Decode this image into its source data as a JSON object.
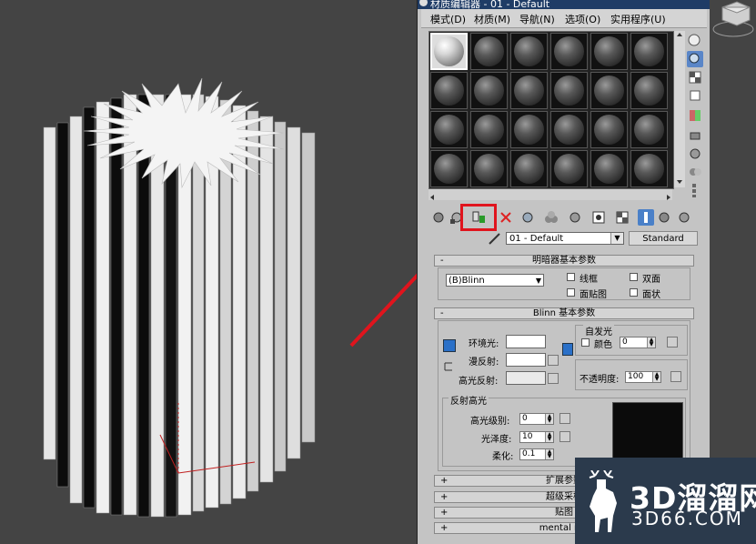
{
  "window_title": "材质编辑器 - 01 - Default",
  "menu": [
    "模式(D)",
    "材质(M)",
    "导航(N)",
    "选项(O)",
    "实用程序(U)"
  ],
  "material_name": "01 - Default",
  "material_type": "Standard",
  "shader_params": {
    "title": "明暗器基本参数",
    "shader": "(B)Blinn",
    "wire": "线框",
    "two_sided": "双面",
    "face_map": "面贴图",
    "faceted": "面状"
  },
  "blinn_params": {
    "title": "Blinn 基本参数",
    "self_illum": "自发光",
    "color_label": "颜色",
    "color_value": "0",
    "ambient": "环境光:",
    "diffuse": "漫反射:",
    "specular": "高光反射:",
    "opacity_label": "不透明度:",
    "opacity_value": "100"
  },
  "highlights": {
    "title": "反射高光",
    "spec_level": "高光级别:",
    "spec_level_value": "0",
    "glossiness": "光泽度:",
    "glossiness_value": "10",
    "soften": "柔化:",
    "soften_value": "0.1"
  },
  "rollouts": [
    "扩展参数",
    "超级采样",
    "贴图",
    "mental ray"
  ],
  "logo": {
    "line1": "3D溜溜网",
    "line2": "3D66.COM"
  },
  "colors": {
    "highlight": "#e0141d",
    "arrow": "#e0141d",
    "selected_tool": "#4a80c8"
  }
}
